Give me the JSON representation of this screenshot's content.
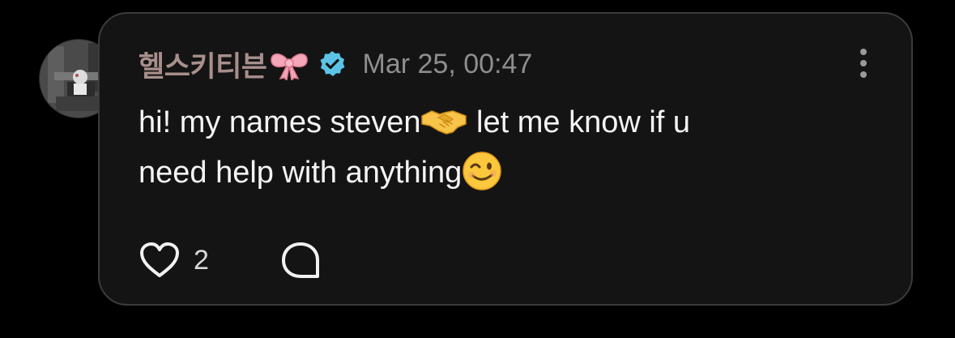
{
  "post": {
    "username": "헬스키티븐",
    "timestamp": "Mar 25, 00:47",
    "message_line1": "hi! my names steven",
    "message_line1_after": " let me know if u",
    "message_line2": "need help with anything",
    "like_count": "2",
    "icons": {
      "username_emoji": "bow-icon",
      "badge": "verified-icon",
      "menu": "more-options-icon",
      "message_emoji_1": "handshake-icon",
      "message_emoji_2": "winking-face-icon",
      "like": "heart-icon",
      "reply": "reply-icon"
    },
    "colors": {
      "background": "#000000",
      "card": "#141414",
      "card_border": "#3b3b3b",
      "username": "#a88f8c",
      "timestamp": "#8e8e8e",
      "text": "#f5f5f5",
      "verified": "#5bc3e6",
      "bow": "#f4a7b9"
    }
  }
}
